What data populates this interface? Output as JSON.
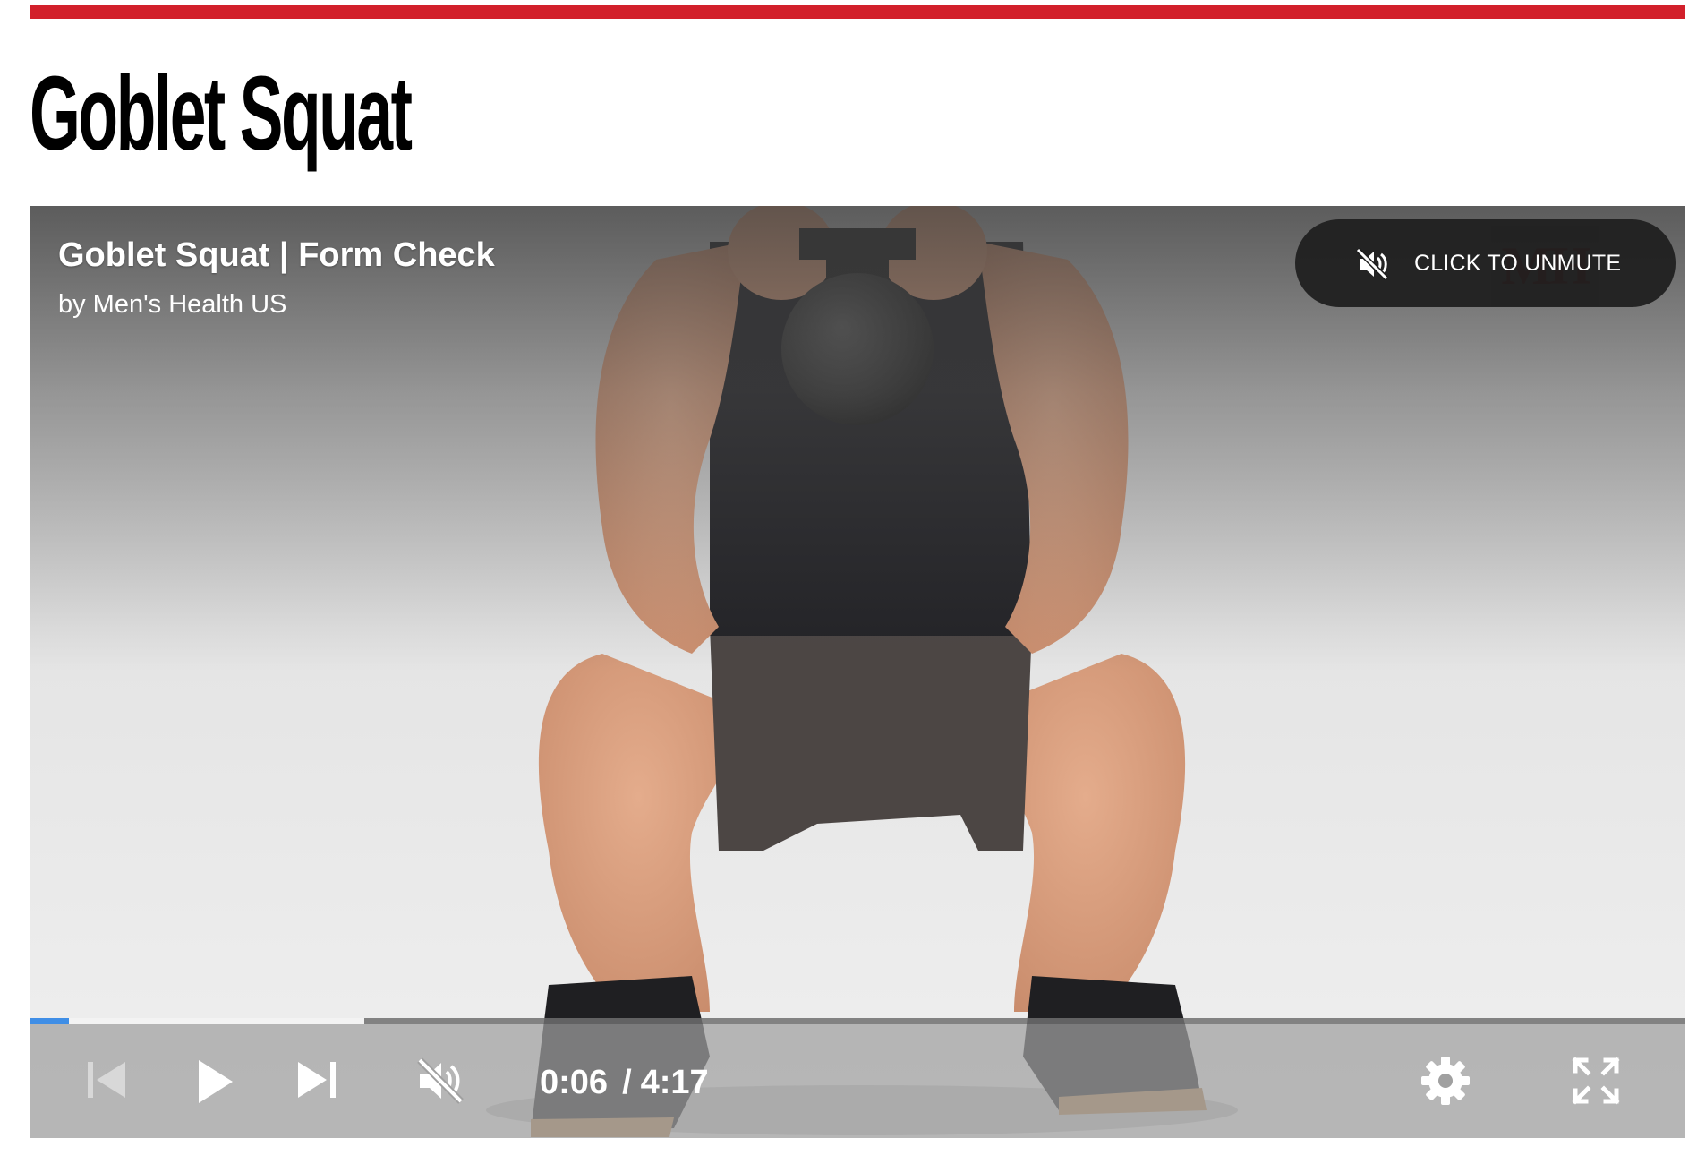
{
  "page": {
    "title": "Goblet Squat",
    "accent_color": "#d2202b"
  },
  "player": {
    "title": "Goblet Squat | Form Check",
    "author": "by Men's Health US",
    "unmute_label": "CLICK TO UNMUTE",
    "watermark": "MH",
    "current_time": "0:06",
    "time_separator": "/",
    "duration": "4:17",
    "progress_played_fraction": 0.024,
    "progress_buffered_fraction": 0.202,
    "progress_color": "#3f8ee6",
    "muted": true,
    "icons": {
      "previous": "skip-previous-icon",
      "play": "play-icon",
      "next": "skip-next-icon",
      "volume": "volume-muted-icon",
      "settings": "gear-icon",
      "fullscreen": "fullscreen-icon",
      "unmute": "volume-muted-icon"
    }
  }
}
